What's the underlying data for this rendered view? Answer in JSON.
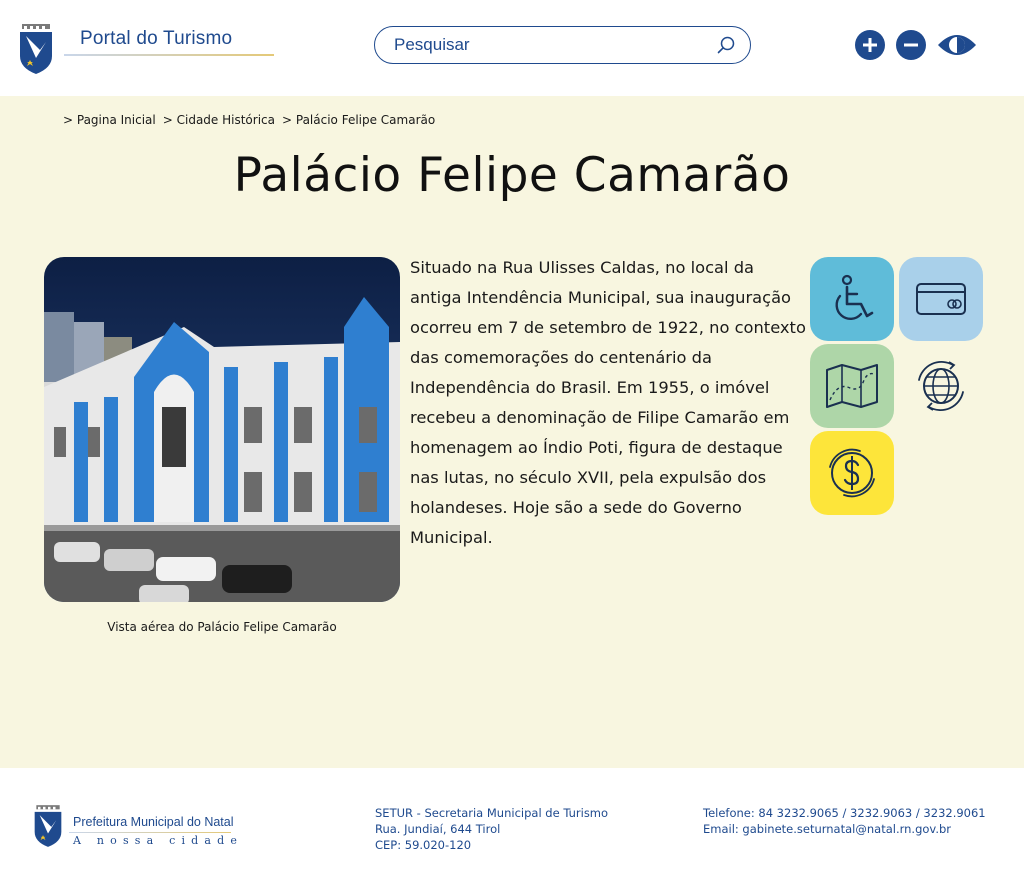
{
  "header": {
    "logo_title": "Portal do Turismo",
    "search_placeholder": "Pesquisar",
    "accent": "#1f4a8e"
  },
  "breadcrumb": [
    "> Pagina Inicial",
    "> Cidade Histórica",
    "> Palácio Felipe Camarão"
  ],
  "main": {
    "title": "Palácio Felipe Camarão",
    "description": "Situado na Rua Ulisses Caldas, no local da antiga Intendência Municipal, sua inauguração ocorreu em 7 de setembro de 1922, no contexto das comemorações do centenário da Independência do Brasil. Em 1955, o imóvel recebeu a denominação de Filipe Camarão em homenagem ao Índio Poti, figura de destaque nas lutas, no século XVII, pela expulsão dos holandeses. Hoje são a sede do Governo Municipal.",
    "photo_caption": "Vista aérea do Palácio Felipe Camarão",
    "background": "#f8f6e0"
  },
  "features": [
    {
      "icon": "wheelchair-accessibility-icon",
      "color": "#5fbcd9"
    },
    {
      "icon": "credit-card-icon",
      "color": "#a9d0ea"
    },
    {
      "icon": "map-icon",
      "color": "#aed6a8"
    },
    {
      "icon": "globe-icon",
      "color": "transparent"
    },
    {
      "icon": "currency-exchange-icon",
      "color": "#fde53a"
    }
  ],
  "footer": {
    "logo_title": "Prefeitura Municipal do Natal",
    "logo_subtitle": "A nossa cidade",
    "org": "SETUR - Secretaria Municipal de Turismo",
    "address": "Rua. Jundiaí, 644 Tirol",
    "cep": "CEP: 59.020-120",
    "phone": "Telefone: 84 3232.9065 / 3232.9063 / 3232.9061",
    "email": "Email: gabinete.seturnatal@natal.rn.gov.br"
  }
}
